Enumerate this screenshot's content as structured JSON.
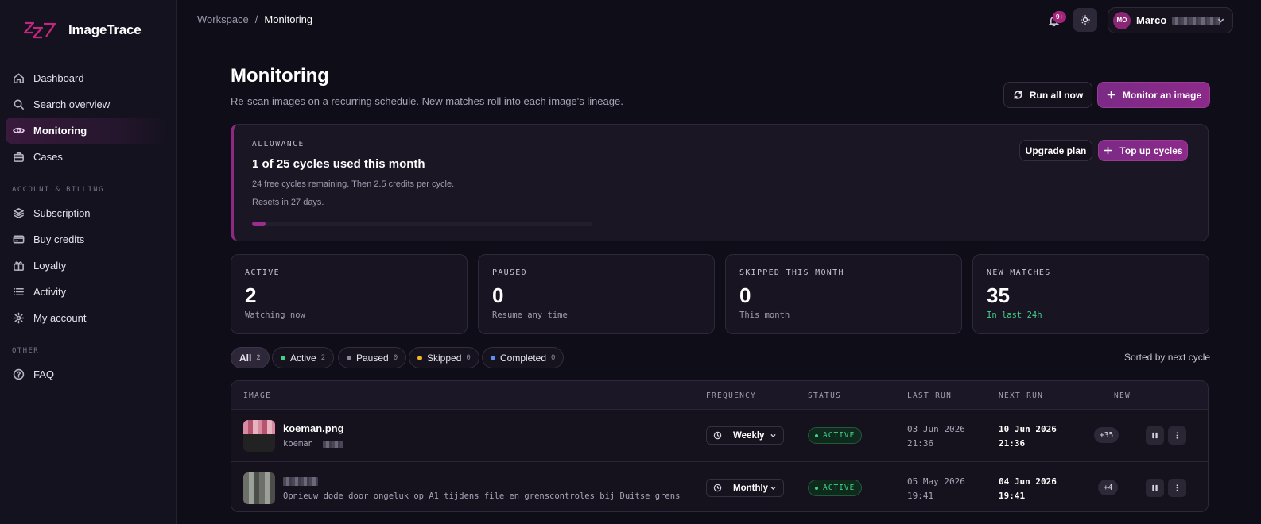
{
  "app": {
    "name": "ImageTrace"
  },
  "sidebar": {
    "items": [
      {
        "label": "Dashboard"
      },
      {
        "label": "Search overview"
      },
      {
        "label": "Monitoring"
      },
      {
        "label": "Cases"
      }
    ],
    "section_billing": "ACCOUNT & BILLING",
    "billing_items": [
      {
        "label": "Subscription"
      },
      {
        "label": "Buy credits"
      },
      {
        "label": "Loyalty"
      },
      {
        "label": "Activity"
      },
      {
        "label": "My account"
      }
    ],
    "section_other": "OTHER",
    "other_items": [
      {
        "label": "FAQ"
      }
    ]
  },
  "topbar": {
    "breadcrumb": [
      "Workspace",
      "/",
      "Monitoring"
    ],
    "notifications_badge": "9+",
    "user": {
      "initials": "MO",
      "name": "Marco"
    }
  },
  "header": {
    "title": "Monitoring",
    "subtitle": "Re-scan images on a recurring schedule. New matches roll into each image's lineage.",
    "run_all": "Run all now",
    "monitor_image": "Monitor an image"
  },
  "allowance": {
    "label": "ALLOWANCE",
    "title": "1 of 25 cycles used this month",
    "line1": "24 free cycles remaining. Then 2.5 credits per cycle.",
    "line2": "Resets in 27 days.",
    "used_fraction": 0.04,
    "upgrade": "Upgrade plan",
    "top_up": "Top up cycles"
  },
  "stats": [
    {
      "label": "ACTIVE",
      "value": "2",
      "note": "Watching now"
    },
    {
      "label": "PAUSED",
      "value": "0",
      "note": "Resume any time"
    },
    {
      "label": "SKIPPED THIS MONTH",
      "value": "0",
      "note": "This month"
    },
    {
      "label": "NEW MATCHES",
      "value": "35",
      "note": "In last 24h"
    }
  ],
  "filters": [
    {
      "label": "All",
      "count": "2"
    },
    {
      "label": "Active",
      "count": "2",
      "color": "#3fd08a"
    },
    {
      "label": "Paused",
      "count": "0",
      "color": "#8d879c"
    },
    {
      "label": "Skipped",
      "count": "0",
      "color": "#f0b429"
    },
    {
      "label": "Completed",
      "count": "0",
      "color": "#5b8ff0"
    }
  ],
  "sorted_label": "Sorted by next cycle",
  "table": {
    "headers": [
      "IMAGE",
      "FREQUENCY",
      "STATUS",
      "LAST RUN",
      "NEXT RUN",
      "NEW"
    ],
    "rows": [
      {
        "name": "koeman.png",
        "sub": "koeman",
        "frequency": "Weekly",
        "status": "ACTIVE",
        "last_run_date": "03 Jun 2026",
        "last_run_time": "21:36",
        "next_run_date": "10 Jun 2026",
        "next_run_time": "21:36",
        "new": "+35"
      },
      {
        "name": "",
        "sub": "Opnieuw dode door ongeluk op A1 tijdens file en grenscontroles bij Duitse grens",
        "frequency": "Monthly",
        "status": "ACTIVE",
        "last_run_date": "05 May 2026",
        "last_run_time": "19:41",
        "next_run_date": "04 Jun 2026",
        "next_run_time": "19:41",
        "new": "+4"
      }
    ]
  }
}
